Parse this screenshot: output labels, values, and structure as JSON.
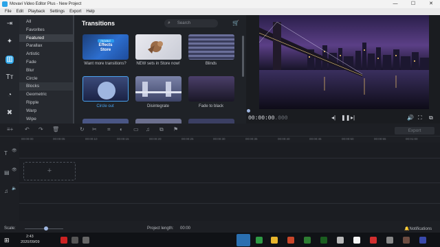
{
  "window": {
    "title": "Movavi Video Editor Plus - New Project",
    "controls": [
      "—",
      "☐",
      "✕"
    ]
  },
  "menu": [
    "File",
    "Edit",
    "Playback",
    "Settings",
    "Export",
    "Help"
  ],
  "sidebar": {
    "icons": [
      "import-icon",
      "magic-wand-icon",
      "transitions-icon",
      "titles-icon",
      "clock-icon",
      "tools-icon"
    ],
    "active_index": 2
  },
  "categories": {
    "items": [
      "All",
      "Favorites",
      "Featured",
      "Parallax",
      "Artistic",
      "Fade",
      "Blur",
      "Circle",
      "Blocks",
      "Geometric",
      "Ripple",
      "Warp",
      "Wipe"
    ],
    "selected": "Featured"
  },
  "gallery": {
    "heading": "Transitions",
    "search_placeholder": "Search",
    "tiles": [
      {
        "label": "Want more transitions?",
        "badge_small": "movavi",
        "badge": "Effects Store"
      },
      {
        "label": "NEW sets in Store now!"
      },
      {
        "label": "Blinds"
      },
      {
        "label": "Circle out",
        "selected": true
      },
      {
        "label": "Disintegrate"
      },
      {
        "label": "Fade to black"
      }
    ]
  },
  "preview": {
    "time_main": "00:00:00",
    "time_frac": ".000"
  },
  "timeline": {
    "export_label": "Export",
    "ruler_ticks": [
      "00:00:00",
      "00:00:05",
      "00:00:10",
      "00:00:15",
      "00:00:20",
      "00:00:25",
      "00:00:30",
      "00:00:35",
      "00:00:40",
      "00:00:45",
      "00:00:50",
      "00:00:55",
      "00:01:00"
    ],
    "drop_zone": "+"
  },
  "status": {
    "scale_label": "Scale:",
    "project_length_label": "Project length:",
    "project_length_value": "00:00",
    "notifications_label": "Notifications"
  },
  "taskbar": {
    "time": "2:43",
    "date": "2020/09/09"
  }
}
